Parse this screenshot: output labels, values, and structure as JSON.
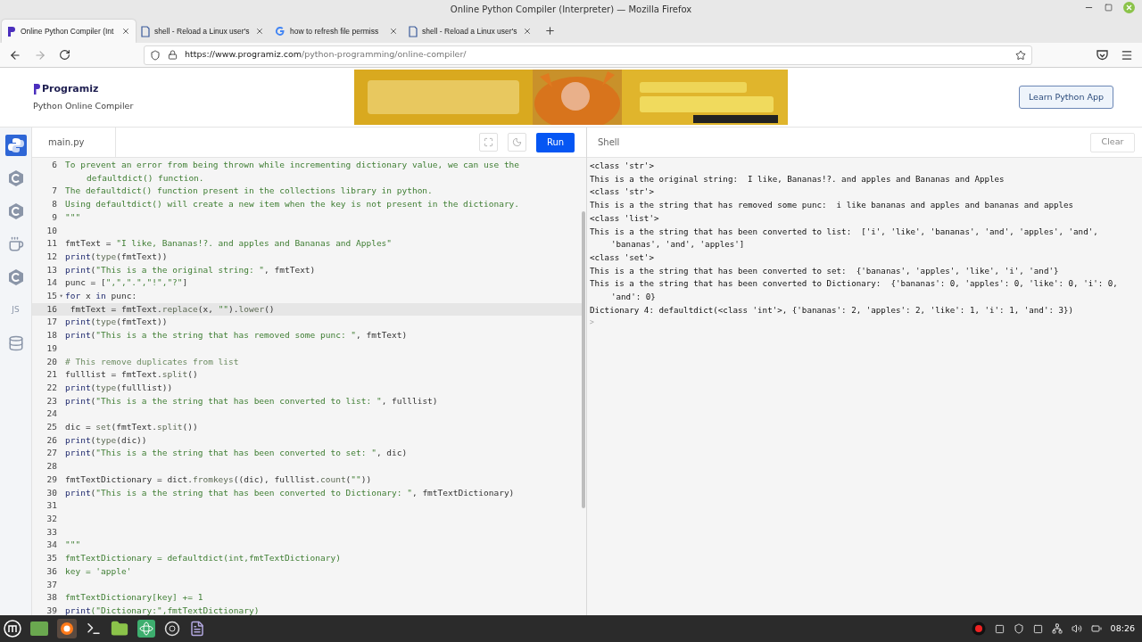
{
  "window": {
    "title": "Online Python Compiler (Interpreter) — Mozilla Firefox"
  },
  "tabs": [
    {
      "label": "Online Python Compiler (Int",
      "selected": true
    },
    {
      "label": "shell - Reload a Linux user's",
      "selected": false
    },
    {
      "label": "how to refresh file permiss",
      "selected": false
    },
    {
      "label": "shell - Reload a Linux user's",
      "selected": false
    }
  ],
  "address_bar": {
    "url_host": "https://www.programiz.com",
    "url_path": "/python-programming/online-compiler/"
  },
  "header": {
    "logo": "Programiz",
    "subtitle": "Python Online Compiler",
    "app_button": "Learn Python App"
  },
  "sidebar": {
    "items": [
      {
        "selected": true
      },
      {
        "selected": false
      },
      {
        "selected": false
      },
      {
        "selected": false
      },
      {
        "selected": false
      },
      {
        "label": "JS",
        "selected": false
      },
      {
        "selected": false
      }
    ]
  },
  "editor": {
    "file_tab": "main.py",
    "run_button": "Run",
    "lines": [
      {
        "number": "6",
        "segments": [
          {
            "kind": "str",
            "text": "To prevent an error from being thrown while incrementing dictionary value, we can use the defaultdict() function."
          }
        ]
      },
      {
        "number": "7",
        "segments": [
          {
            "kind": "str",
            "text": "The defaultdict() function present in the collections library in python."
          }
        ]
      },
      {
        "number": "8",
        "segments": [
          {
            "kind": "str",
            "text": "Using defaultdict() will create a new item when the key is not present in the dictionary."
          }
        ]
      },
      {
        "number": "9",
        "segments": [
          {
            "kind": "str",
            "text": "\"\"\""
          }
        ]
      },
      {
        "number": "10"
      },
      {
        "number": "11",
        "segments": [
          {
            "kind": "plain",
            "text": "fmtText = "
          },
          {
            "kind": "str",
            "text": "\"I like, Bananas!?. and apples and Bananas and Apples\""
          }
        ]
      },
      {
        "number": "12",
        "segments": [
          {
            "kind": "kw",
            "text": "print"
          },
          {
            "kind": "plain",
            "text": "("
          },
          {
            "kind": "call",
            "text": "type"
          },
          {
            "kind": "plain",
            "text": "(fmtText))"
          }
        ]
      },
      {
        "number": "13",
        "segments": [
          {
            "kind": "kw",
            "text": "print"
          },
          {
            "kind": "plain",
            "text": "("
          },
          {
            "kind": "str",
            "text": "\"This is a the original string: \""
          },
          {
            "kind": "plain",
            "text": ", fmtText)"
          }
        ]
      },
      {
        "number": "14",
        "segments": [
          {
            "kind": "plain",
            "text": "punc = ["
          },
          {
            "kind": "str",
            "text": "\",\",\".\",\"!\",\"?\""
          },
          {
            "kind": "plain",
            "text": "]"
          }
        ]
      },
      {
        "number": "15",
        "fold": "▾",
        "segments": [
          {
            "kind": "kw",
            "text": "for"
          },
          {
            "kind": "plain",
            "text": " x "
          },
          {
            "kind": "kw",
            "text": "in"
          },
          {
            "kind": "plain",
            "text": " punc:"
          }
        ]
      },
      {
        "number": "16",
        "active": true,
        "segments": [
          {
            "kind": "plain",
            "text": " fmtText = fmtText."
          },
          {
            "kind": "call",
            "text": "replace"
          },
          {
            "kind": "plain",
            "text": "(x, "
          },
          {
            "kind": "str",
            "text": "\"\""
          },
          {
            "kind": "plain",
            "text": ")."
          },
          {
            "kind": "call",
            "text": "lower"
          },
          {
            "kind": "plain",
            "text": "()"
          }
        ]
      },
      {
        "number": "17",
        "segments": [
          {
            "kind": "kw",
            "text": "print"
          },
          {
            "kind": "plain",
            "text": "("
          },
          {
            "kind": "call",
            "text": "type"
          },
          {
            "kind": "plain",
            "text": "(fmtText))"
          }
        ]
      },
      {
        "number": "18",
        "segments": [
          {
            "kind": "kw",
            "text": "print"
          },
          {
            "kind": "plain",
            "text": "("
          },
          {
            "kind": "str",
            "text": "\"This is a the string that has removed some punc: \""
          },
          {
            "kind": "plain",
            "text": ", fmtText)"
          }
        ]
      },
      {
        "number": "19"
      },
      {
        "number": "20",
        "segments": [
          {
            "kind": "comment",
            "text": "# This remove duplicates from list"
          }
        ]
      },
      {
        "number": "21",
        "segments": [
          {
            "kind": "plain",
            "text": "fulllist = fmtText."
          },
          {
            "kind": "call",
            "text": "split"
          },
          {
            "kind": "plain",
            "text": "()"
          }
        ]
      },
      {
        "number": "22",
        "segments": [
          {
            "kind": "kw",
            "text": "print"
          },
          {
            "kind": "plain",
            "text": "("
          },
          {
            "kind": "call",
            "text": "type"
          },
          {
            "kind": "plain",
            "text": "(fulllist))"
          }
        ]
      },
      {
        "number": "23",
        "segments": [
          {
            "kind": "kw",
            "text": "print"
          },
          {
            "kind": "plain",
            "text": "("
          },
          {
            "kind": "str",
            "text": "\"This is a the string that has been converted to list: \""
          },
          {
            "kind": "plain",
            "text": ", fulllist)"
          }
        ]
      },
      {
        "number": "24"
      },
      {
        "number": "25",
        "segments": [
          {
            "kind": "plain",
            "text": "dic = "
          },
          {
            "kind": "call",
            "text": "set"
          },
          {
            "kind": "plain",
            "text": "(fmtText."
          },
          {
            "kind": "call",
            "text": "split"
          },
          {
            "kind": "plain",
            "text": "())"
          }
        ]
      },
      {
        "number": "26",
        "segments": [
          {
            "kind": "kw",
            "text": "print"
          },
          {
            "kind": "plain",
            "text": "("
          },
          {
            "kind": "call",
            "text": "type"
          },
          {
            "kind": "plain",
            "text": "(dic))"
          }
        ]
      },
      {
        "number": "27",
        "segments": [
          {
            "kind": "kw",
            "text": "print"
          },
          {
            "kind": "plain",
            "text": "("
          },
          {
            "kind": "str",
            "text": "\"This is a the string that has been converted to set: \""
          },
          {
            "kind": "plain",
            "text": ", dic)"
          }
        ]
      },
      {
        "number": "28"
      },
      {
        "number": "29",
        "segments": [
          {
            "kind": "plain",
            "text": "fmtTextDictionary = dict."
          },
          {
            "kind": "call",
            "text": "fromkeys"
          },
          {
            "kind": "plain",
            "text": "((dic), fulllist."
          },
          {
            "kind": "call",
            "text": "count"
          },
          {
            "kind": "plain",
            "text": "("
          },
          {
            "kind": "str",
            "text": "\"\""
          },
          {
            "kind": "plain",
            "text": "))"
          }
        ]
      },
      {
        "number": "30",
        "segments": [
          {
            "kind": "kw",
            "text": "print"
          },
          {
            "kind": "plain",
            "text": "("
          },
          {
            "kind": "str",
            "text": "\"This is a the string that has been converted to Dictionary: \""
          },
          {
            "kind": "plain",
            "text": ", fmtTextDictionary)"
          }
        ]
      },
      {
        "number": "31"
      },
      {
        "number": "32"
      },
      {
        "number": "33"
      },
      {
        "number": "34",
        "segments": [
          {
            "kind": "str",
            "text": "\"\"\""
          }
        ]
      },
      {
        "number": "35",
        "segments": [
          {
            "kind": "str",
            "text": "fmtTextDictionary = defaultdict(int,fmtTextDictionary)"
          }
        ]
      },
      {
        "number": "36",
        "segments": [
          {
            "kind": "str",
            "text": "key = 'apple'"
          }
        ]
      },
      {
        "number": "37"
      },
      {
        "number": "38",
        "segments": [
          {
            "kind": "str",
            "text": "fmtTextDictionary[key] += 1"
          }
        ]
      },
      {
        "number": "39",
        "segments": [
          {
            "kind": "kw",
            "text": "print"
          },
          {
            "kind": "str",
            "text": "(\"Dictionary:\",fmtTextDictionary)"
          }
        ]
      }
    ]
  },
  "shell": {
    "title": "Shell",
    "clear_button": "Clear",
    "lines": [
      "<class 'str'>",
      "This is a the original string:  I like, Bananas!?. and apples and Bananas and Apples",
      "<class 'str'>",
      "This is a the string that has removed some punc:  i like bananas and apples and bananas and apples",
      "<class 'list'>",
      "This is a the string that has been converted to list:  ['i', 'like', 'bananas', 'and', 'apples', 'and', 'bananas', 'and', 'apples']",
      "<class 'set'>",
      "This is a the string that has been converted to set:  {'bananas', 'apples', 'like', 'i', 'and'}",
      "This is a the string that has been converted to Dictionary:  {'bananas': 0, 'apples': 0, 'like': 0, 'i': 0, 'and': 0}",
      "Dictionary 4: defaultdict(<class 'int'>, {'bananas': 2, 'apples': 2, 'like': 1, 'i': 1, 'and': 3})"
    ],
    "prompt": ">"
  },
  "taskbar": {
    "clock": "08:26"
  }
}
